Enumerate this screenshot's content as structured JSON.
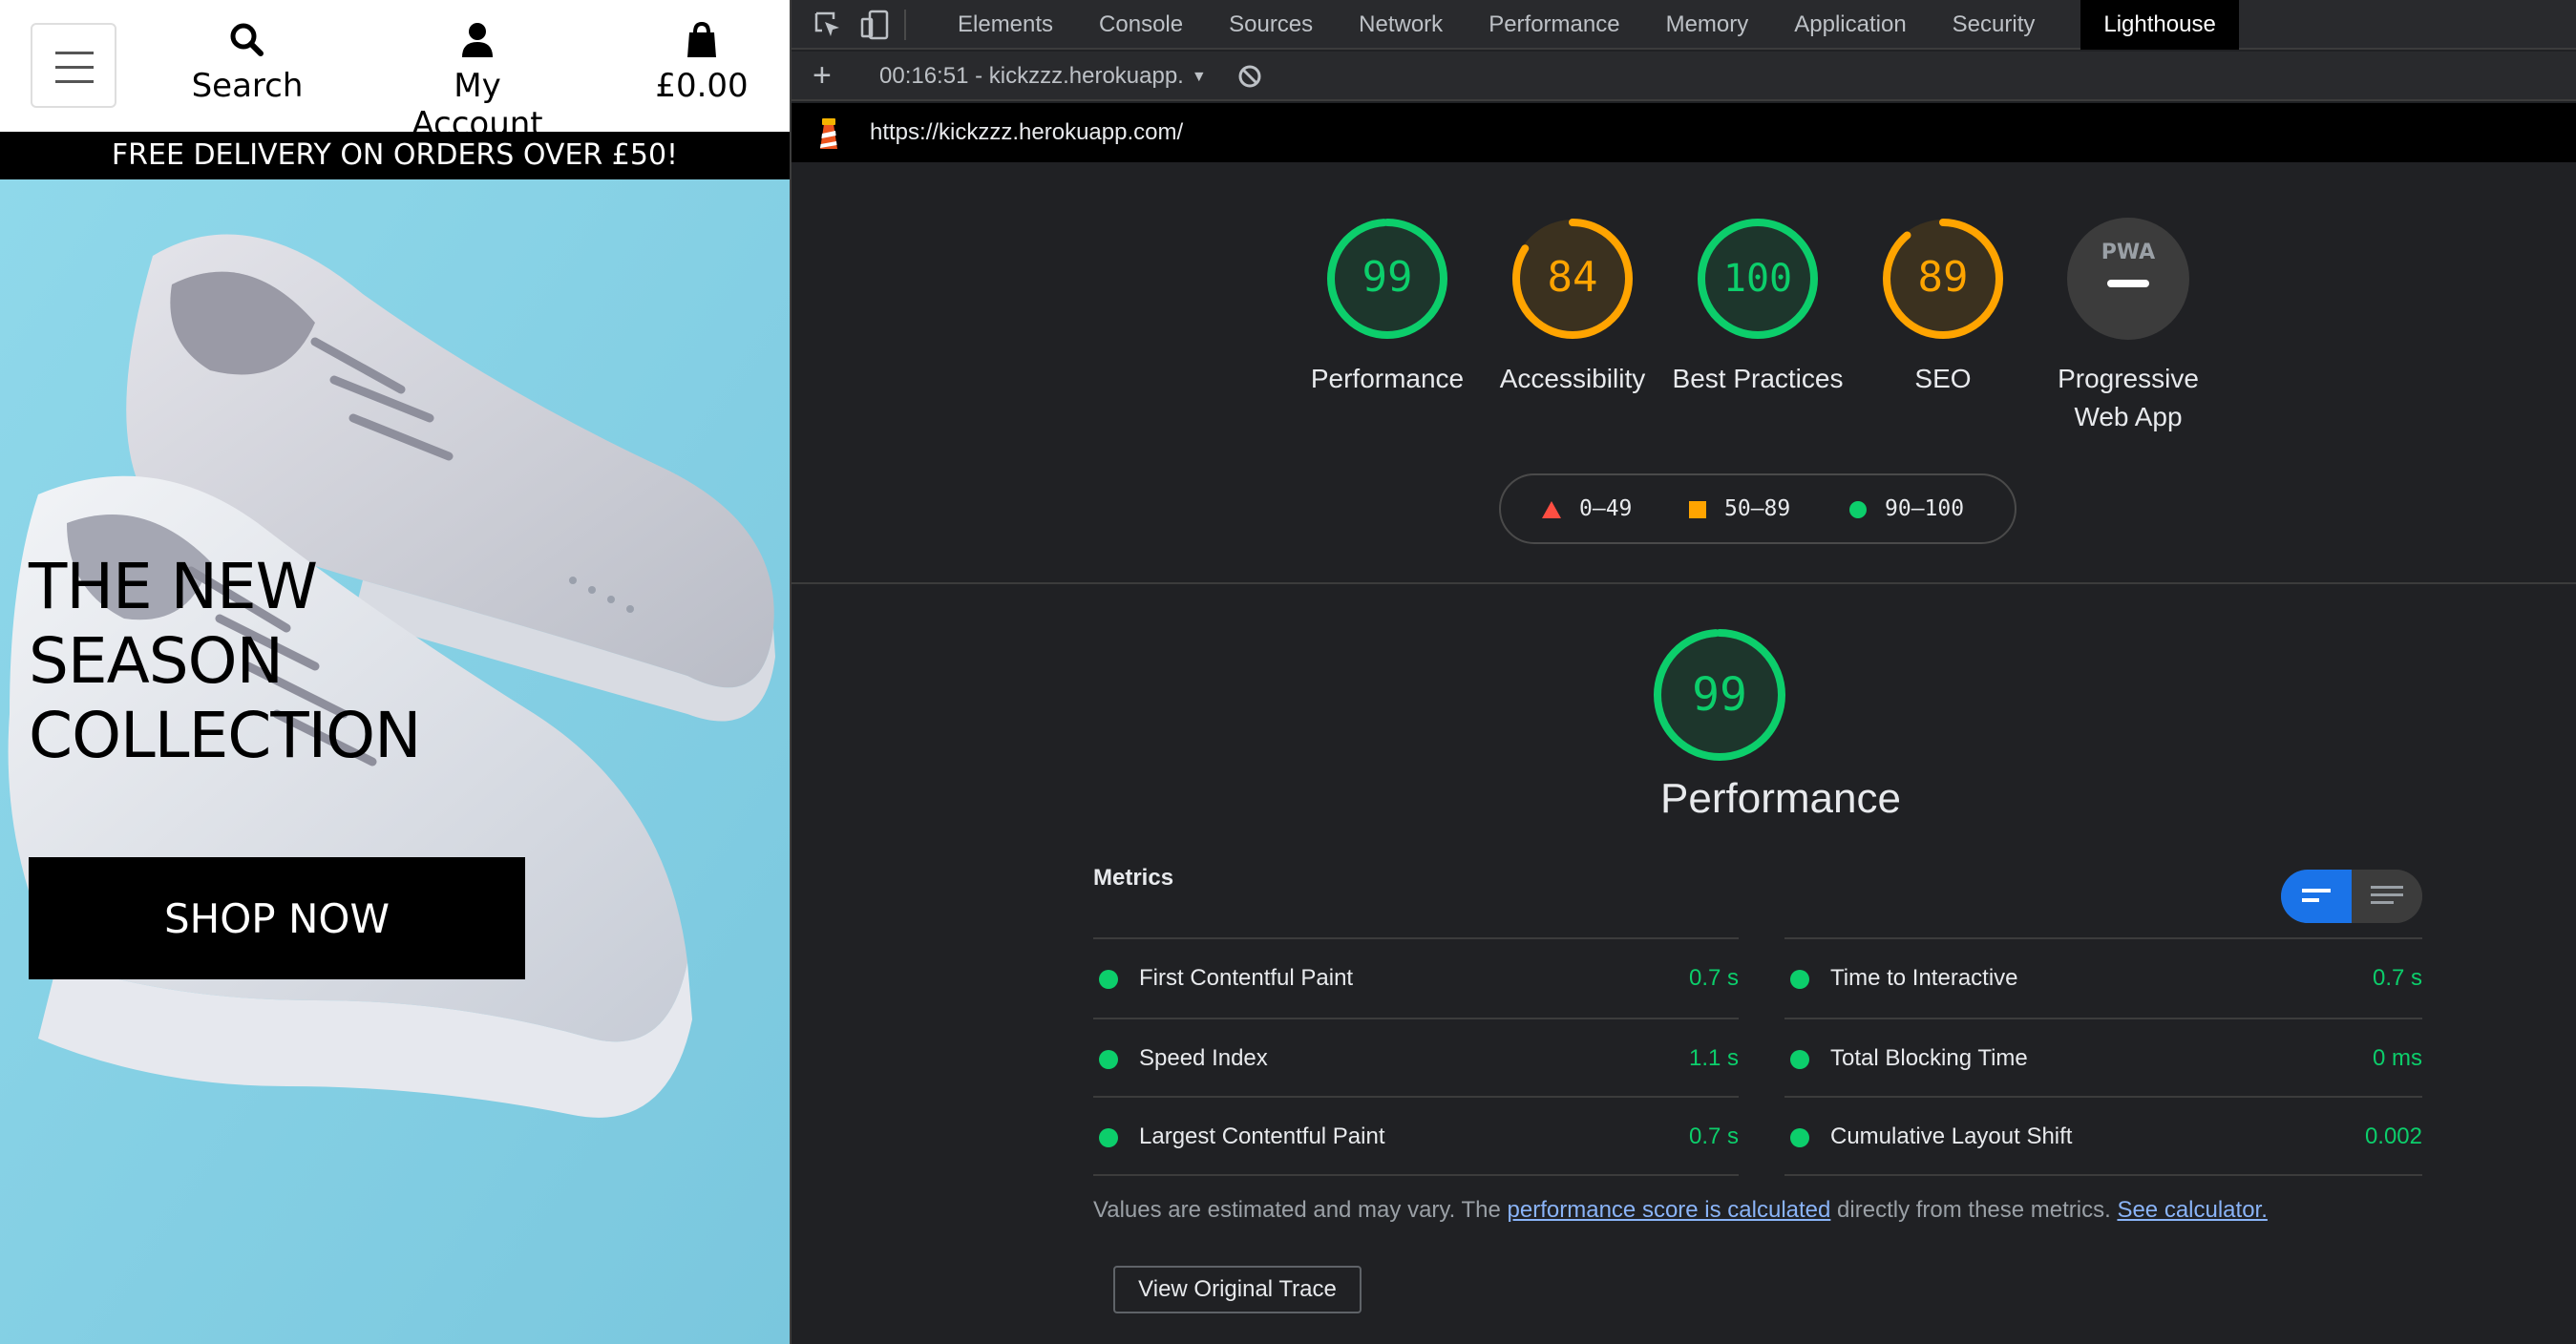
{
  "site": {
    "header": {
      "menu_icon": "hamburger-icon",
      "search": {
        "label": "Search",
        "icon": "magnifier-icon"
      },
      "account": {
        "label": "My Account",
        "icon": "user-icon"
      },
      "bag": {
        "label": "£0.00",
        "icon": "shopping-bag-icon"
      }
    },
    "delivery_banner": "FREE DELIVERY ON ORDERS OVER £50!",
    "hero": {
      "title_lines": [
        "THE NEW",
        "SEASON",
        "COLLECTION"
      ],
      "cta": "SHOP NOW",
      "background_color": "#8fd3e6"
    }
  },
  "devtools": {
    "tabs": [
      "Elements",
      "Console",
      "Sources",
      "Network",
      "Performance",
      "Memory",
      "Application",
      "Security",
      "Lighthouse"
    ],
    "active_tab": "Lighthouse",
    "toolbar": {
      "add_icon": "plus-icon",
      "report_selector": "00:16:51 - kickzzz.herokuapp.",
      "clear_icon": "block-icon"
    },
    "report_url": "https://kickzzz.herokuapp.com/",
    "scores": [
      {
        "label": "Performance",
        "score": 99,
        "score_text": "99",
        "rating": "pass"
      },
      {
        "label": "Accessibility",
        "score": 84,
        "score_text": "84",
        "rating": "average"
      },
      {
        "label": "Best Practices",
        "score": 100,
        "score_text": "100",
        "rating": "pass"
      },
      {
        "label": "SEO",
        "score": 89,
        "score_text": "89",
        "rating": "average"
      },
      {
        "label": "Progressive Web App",
        "score": null,
        "score_text": "PWA",
        "rating": "na"
      }
    ],
    "legend": [
      {
        "range": "0–49",
        "shape": "triangle",
        "color": "#ff4e42"
      },
      {
        "range": "50–89",
        "shape": "square",
        "color": "#ffa400"
      },
      {
        "range": "90–100",
        "shape": "circle",
        "color": "#0cce6b"
      }
    ],
    "performance": {
      "score": 99,
      "score_text": "99",
      "title": "Performance",
      "metrics_title": "Metrics",
      "metrics": [
        {
          "name": "First Contentful Paint",
          "value": "0.7 s"
        },
        {
          "name": "Time to Interactive",
          "value": "0.7 s"
        },
        {
          "name": "Speed Index",
          "value": "1.1 s"
        },
        {
          "name": "Total Blocking Time",
          "value": "0 ms"
        },
        {
          "name": "Largest Contentful Paint",
          "value": "0.7 s"
        },
        {
          "name": "Cumulative Layout Shift",
          "value": "0.002"
        }
      ],
      "note_prefix": "Values are estimated and may vary. The ",
      "note_link1": "performance score is calculated",
      "note_middle": " directly from these metrics. ",
      "note_link2": "See calculator.",
      "view_trace": "View Original Trace"
    },
    "colors": {
      "pass": "#0cce6b",
      "average": "#ffa400",
      "fail": "#ff4e42",
      "accent": "#1a73e8",
      "panel_bg": "#202124"
    }
  }
}
